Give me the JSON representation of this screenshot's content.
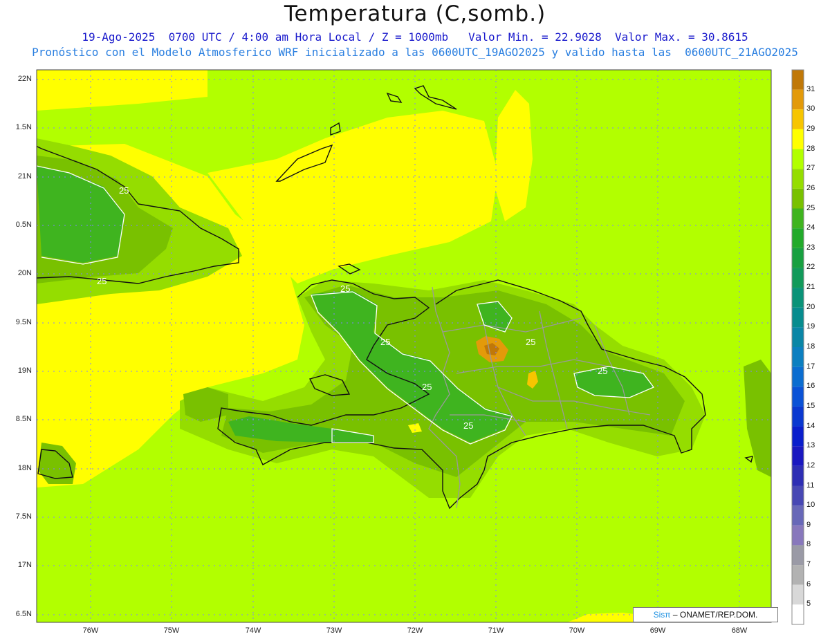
{
  "title": "Temperatura (C,somb.)",
  "subtitle_line1": "19-Ago-2025  0700 UTC / 4:00 am Hora Local / Z = 1000mb   Valor Min. = 22.9028  Valor Max. = 30.8615",
  "subtitle_line2": "Pronóstico con el Modelo Atmosferico WRF inicializado a las 0600UTC_19AGO2025 y valido hasta las  0600UTC_21AGO2025",
  "lat_labels": [
    "22N",
    "1.5N",
    "21N",
    "0.5N",
    "20N",
    "9.5N",
    "19N",
    "8.5N",
    "18N",
    "7.5N",
    "17N",
    "6.5N"
  ],
  "lon_labels": [
    "76W",
    "75W",
    "74W",
    "73W",
    "72W",
    "71W",
    "70W",
    "69W",
    "68W"
  ],
  "contour_label": "25",
  "colorbar": {
    "values": [
      "31",
      "30",
      "29",
      "28",
      "27",
      "26",
      "25",
      "24",
      "23",
      "22",
      "21",
      "20",
      "19",
      "18",
      "17",
      "16",
      "15",
      "14",
      "13",
      "12",
      "11",
      "10",
      "9",
      "8",
      "7",
      "6",
      "5"
    ],
    "colors": [
      "#c07808",
      "#e39a0a",
      "#f7c500",
      "#ffff00",
      "#b2ff00",
      "#95dd00",
      "#79c100",
      "#3fb41f",
      "#22aa2a",
      "#18a040",
      "#129a5a",
      "#0a9378",
      "#078c8e",
      "#0a86a6",
      "#0c7fc0",
      "#0b6dd0",
      "#0a52d6",
      "#0a38d0",
      "#0a1ecc",
      "#1a18c0",
      "#2e2eb4",
      "#4848b4",
      "#6868b8",
      "#8878bc",
      "#9a9aa6",
      "#b2b2b2",
      "#d8d8d8",
      "#ffffff"
    ]
  },
  "credit": {
    "brand": "Sisπ",
    "text": " – ONAMET/REP.DOM."
  },
  "colors": {
    "sea_base": "#b2ff00",
    "warm_29": "#ffff00",
    "land_26": "#95dd00",
    "land_25": "#79c100",
    "land_24": "#3fb41f",
    "hot_30": "#e39a0a",
    "hot_31": "#c07808",
    "coast": "#111111",
    "border": "#9a9a9a",
    "contour": "#ffffff",
    "grid": "#8080ff"
  }
}
